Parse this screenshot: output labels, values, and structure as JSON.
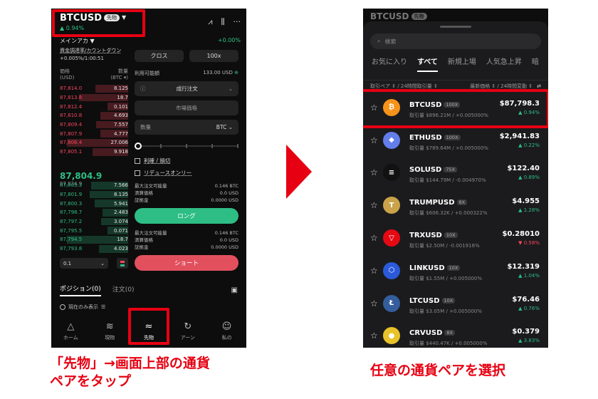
{
  "left": {
    "pair": "BTCUSD",
    "pair_tag": "先物",
    "pair_caret": "▼",
    "change": "▲ 0.94%",
    "sub_title": "メインアカ ▼",
    "sub_right": "+0.00%",
    "funding_label": "資金調達率/カウントダウン",
    "funding_value": "+0.005%/1:00:51",
    "ob_header": {
      "left1": "価格",
      "left2": "(USD)",
      "right1": "数量",
      "right2": "(BTC ▾)"
    },
    "asks": [
      {
        "p": "87,814.0",
        "q": "8.125"
      },
      {
        "p": "87,813.8",
        "q": "18.7"
      },
      {
        "p": "87,812.4",
        "q": "0.101"
      },
      {
        "p": "87,810.8",
        "q": "4.693"
      },
      {
        "p": "87,809.4",
        "q": "7.557"
      },
      {
        "p": "87,807.9",
        "q": "4.777"
      },
      {
        "p": "87,806.4",
        "q": "27.006"
      },
      {
        "p": "87,805.1",
        "q": "9.918"
      }
    ],
    "mid_price": "87,804.9",
    "mid_sub": "87,834.9",
    "bids": [
      {
        "p": "87,803.3",
        "q": "7.566"
      },
      {
        "p": "87,801.9",
        "q": "8.135"
      },
      {
        "p": "87,800.3",
        "q": "5.941"
      },
      {
        "p": "87,798.7",
        "q": "2.483"
      },
      {
        "p": "87,797.2",
        "q": "3.074"
      },
      {
        "p": "87,795.5",
        "q": "0.071"
      },
      {
        "p": "87,794.5",
        "q": "18.7"
      },
      {
        "p": "87,793.8",
        "q": "4.023"
      }
    ],
    "form": {
      "cross": "クロス",
      "leverage": "100x",
      "avail_label": "利用可能額",
      "avail_value": "133.00 USD",
      "order_type": "成行注文",
      "market_price": "市場価格",
      "qty_label": "数量",
      "qty_unit": "BTC",
      "tpsl": "利確 / 損切",
      "reduce_only": "リデュースオンリー",
      "long_info": [
        {
          "k": "最大注文可能量",
          "v": "0.146 BTC"
        },
        {
          "k": "清算価格",
          "v": "0.0 USD"
        },
        {
          "k": "証拠金",
          "v": "0.0000 USD"
        }
      ],
      "long_btn": "ロング",
      "short_info": [
        {
          "k": "最大注文可能量",
          "v": "0.146 BTC"
        },
        {
          "k": "清算価格",
          "v": "0.0 USD"
        },
        {
          "k": "証拠金",
          "v": "0.0000 USD"
        }
      ],
      "short_btn": "ショート"
    },
    "depth_select": "0.1",
    "tabs": {
      "positions": "ポジション(0)",
      "orders": "注文(0)"
    },
    "show_current": "現在のみ表示",
    "nav": [
      {
        "label": "ホーム",
        "glyph": "△"
      },
      {
        "label": "現物",
        "glyph": "≋"
      },
      {
        "label": "先物",
        "glyph": "≈"
      },
      {
        "label": "アーン",
        "glyph": "↻"
      },
      {
        "label": "私の",
        "glyph": "☺"
      }
    ]
  },
  "right": {
    "top_pair": "BTCUSD",
    "top_tag": "先物",
    "search_placeholder": "検索",
    "tabs": [
      "お気に入り",
      "すべて",
      "新規上場",
      "人気急上昇",
      "暗"
    ],
    "sort": {
      "left": "取引ペア ⇕ / 24時間取引量 ⇕",
      "right": "最新価格 ⇕ / 24時間変動 ⇕"
    },
    "coins": [
      {
        "sym": "BTCUSD",
        "lev": "100X",
        "vol": "取引量 $896.21M / +0.005000%",
        "price": "$87,798.3",
        "chg": "▲ 0.94%",
        "dir": "up",
        "color": "#f7931a",
        "glyph": "₿"
      },
      {
        "sym": "ETHUSD",
        "lev": "100X",
        "vol": "取引量 $789.64M / +0.005000%",
        "price": "$2,941.83",
        "chg": "▲ 0.22%",
        "dir": "up",
        "color": "#627eea",
        "glyph": "◆"
      },
      {
        "sym": "SOLUSD",
        "lev": "75X",
        "vol": "取引量 $144.79M / -0.004970%",
        "price": "$122.40",
        "chg": "▲ 0.89%",
        "dir": "up",
        "color": "#111111",
        "glyph": "≡"
      },
      {
        "sym": "TRUMPUSD",
        "lev": "8X",
        "vol": "取引量 $606.32K / +0.000322%",
        "price": "$4.955",
        "chg": "▲ 1.28%",
        "dir": "up",
        "color": "#c9a24a",
        "glyph": "T"
      },
      {
        "sym": "TRXUSD",
        "lev": "10X",
        "vol": "取引量 $2.50M / -0.001916%",
        "price": "$0.28010",
        "chg": "▼ 0.58%",
        "dir": "down",
        "color": "#e50914",
        "glyph": "▽"
      },
      {
        "sym": "LINKUSD",
        "lev": "10X",
        "vol": "取引量 $1.55M / +0.005000%",
        "price": "$12.319",
        "chg": "▲ 1.04%",
        "dir": "up",
        "color": "#2a5ada",
        "glyph": "⬡"
      },
      {
        "sym": "LTCUSD",
        "lev": "10X",
        "vol": "取引量 $3.05M / +0.005000%",
        "price": "$76.46",
        "chg": "▲ 0.76%",
        "dir": "up",
        "color": "#345d9d",
        "glyph": "Ł"
      },
      {
        "sym": "CRVUSD",
        "lev": "8X",
        "vol": "取引量 $440.47K / +0.005000%",
        "price": "$0.379",
        "chg": "▲ 3.83%",
        "dir": "up",
        "color": "#e8c22a",
        "glyph": "●"
      }
    ]
  },
  "captions": {
    "left_line1": "「先物」→画面上部の通貨",
    "left_line2": "ペアをタップ",
    "right": "任意の通貨ペアを選択"
  },
  "colors": {
    "accent_red": "#e60012",
    "up": "#2ebd85",
    "down": "#f6465d"
  }
}
